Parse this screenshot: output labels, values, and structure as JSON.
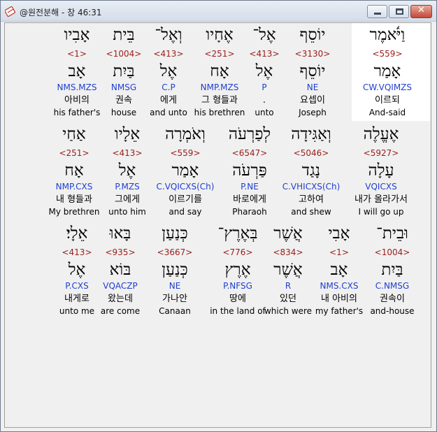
{
  "window": {
    "title": "@원전분해 - 창 46:31",
    "close_label": "✕"
  },
  "rows": [
    [
      {
        "heb": "וַיֹּ֫אמֶר",
        "strong": "<559>",
        "root": "אָמַר",
        "morph": "CW.VQIMZS",
        "kor": "이르되",
        "eng": "And-said"
      },
      {
        "heb": "יוֹסֵף",
        "strong": "<3130>",
        "root": "יוֹסֵף",
        "morph": "NE",
        "kor": "요셉이",
        "eng": "Joseph"
      },
      {
        "heb": "אֶל־",
        "strong": "<413>",
        "root": "אֶל",
        "morph": "P",
        "kor": ".",
        "eng": "unto"
      },
      {
        "heb": "אֶחָיו",
        "strong": "<251>",
        "root": "אָח",
        "morph": "NMP.MZS",
        "kor": "그 형들과",
        "eng": "his brethren"
      },
      {
        "heb": "וְאֶל־",
        "strong": "<413>",
        "root": "אֶל",
        "morph": "C.P",
        "kor": "에게",
        "eng": "and unto"
      },
      {
        "heb": "בֵּית",
        "strong": "<1004>",
        "root": "בַּיִת",
        "morph": "NMSG",
        "kor": "권속",
        "eng": "house"
      },
      {
        "heb": "אָבִיו",
        "strong": "<1>",
        "root": "אָב",
        "morph": "NMS.MZS",
        "kor": "아비의",
        "eng": "his father's"
      }
    ],
    [
      {
        "heb": "אֶעֱלֶה",
        "strong": "<5927>",
        "root": "עָלָה",
        "morph": "VQICXS",
        "kor": "내가 올라가서",
        "eng": "I will go up"
      },
      {
        "heb": "וְאַגִּידָה",
        "strong": "<5046>",
        "root": "נָגַד",
        "morph": "C.VHICXS(Ch)",
        "kor": "고하여",
        "eng": "and shew"
      },
      {
        "heb": "לְפַרְעֹה",
        "strong": "<6547>",
        "root": "פַּרְעֹה",
        "morph": "P.NE",
        "kor": "바로에게",
        "eng": "Pharaoh"
      },
      {
        "heb": "וְאֹמְרָה",
        "strong": "<559>",
        "root": "אָמַר",
        "morph": "C.VQICXS(Ch)",
        "kor": "이르기를",
        "eng": "and say"
      },
      {
        "heb": "אֵלָיו",
        "strong": "<413>",
        "root": "אֶל",
        "morph": "P.MZS",
        "kor": "그에게",
        "eng": "unto him"
      },
      {
        "heb": "אַחַי",
        "strong": "<251>",
        "root": "אָח",
        "morph": "NMP.CXS",
        "kor": "내 형들과",
        "eng": "My brethren"
      }
    ],
    [
      {
        "heb": "וּבֵית־",
        "strong": "<1004>",
        "root": "בַּיִת",
        "morph": "C.NMSG",
        "kor": "권속이",
        "eng": "and-house"
      },
      {
        "heb": "אָבִי",
        "strong": "<1>",
        "root": "אָב",
        "morph": "NMS.CXS",
        "kor": "내 아비의",
        "eng": "my father's"
      },
      {
        "heb": "אֲשֶׁר",
        "strong": "<834>",
        "root": "אֲשֶׁר",
        "morph": "R",
        "kor": "있던",
        "eng": "which were"
      },
      {
        "heb": "בְּאֶרֶץ־",
        "strong": "<776>",
        "root": "אֶרֶץ",
        "morph": "P.NFSG",
        "kor": "땅에",
        "eng": "in the land of"
      },
      {
        "heb": "כְּנַעַן",
        "strong": "<3667>",
        "root": "כְּנַעַן",
        "morph": "NE",
        "kor": "가나안",
        "eng": "Canaan"
      },
      {
        "heb": "בָּאוּ",
        "strong": "<935>",
        "root": "בּוֹא",
        "morph": "VQACZP",
        "kor": "왔는데",
        "eng": "are come"
      },
      {
        "heb": "אֵלָי׃",
        "strong": "<413>",
        "root": "אֶל",
        "morph": "P.CXS",
        "kor": "내게로",
        "eng": "unto me"
      }
    ]
  ]
}
